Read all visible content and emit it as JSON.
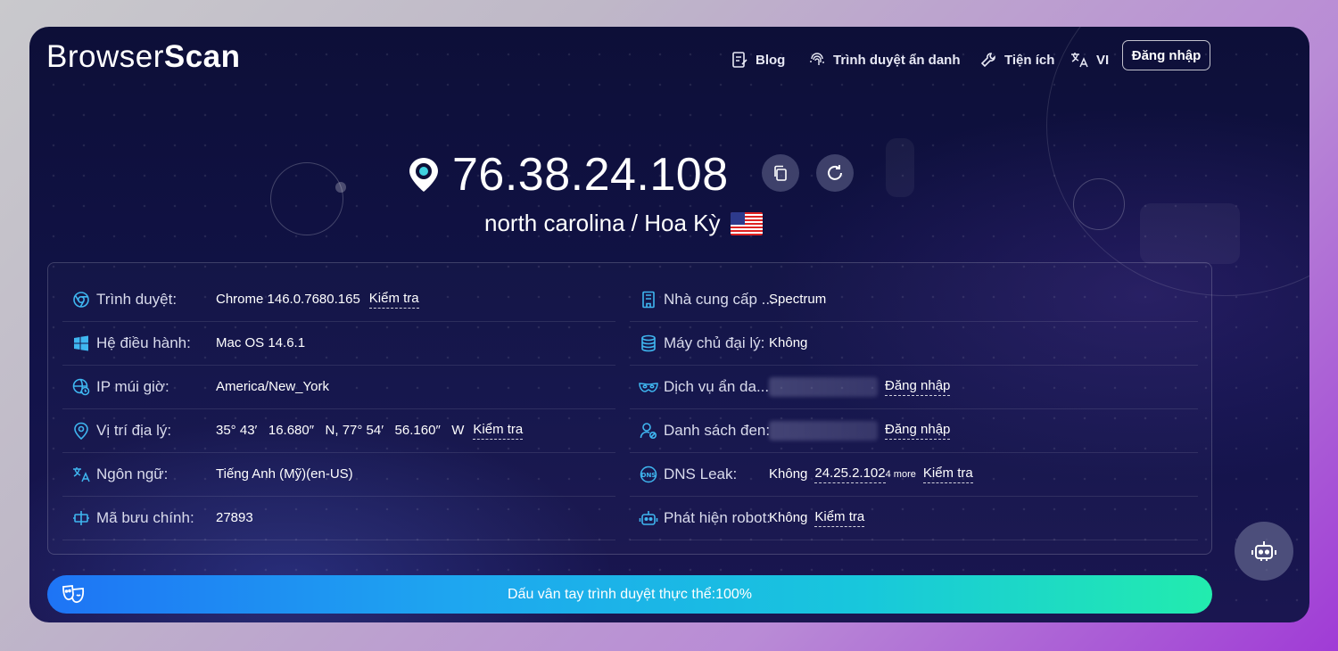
{
  "header": {
    "logo_regular": "Browser",
    "logo_bold": "Scan",
    "nav": {
      "blog": "Blog",
      "incognito": "Trình duyệt ẩn danh",
      "tools": "Tiện ích",
      "language": "VI"
    },
    "login": "Đăng nhập"
  },
  "hero": {
    "ip": "76.38.24.108",
    "location": "north carolina / Hoa Kỳ",
    "flag_icon": "us-flag-icon"
  },
  "info_left": [
    {
      "label": "Trình duyệt:",
      "value": "Chrome 146.0.7680.165",
      "link": "Kiểm tra",
      "icon": "chrome-icon"
    },
    {
      "label": "Hệ điều hành:",
      "value": "Mac OS 14.6.1",
      "icon": "windows-icon"
    },
    {
      "label": "IP múi giờ:",
      "value": "America/New_York",
      "icon": "globe-clock-icon"
    },
    {
      "label": "Vị trí địa lý:",
      "value": "35° 43′   16.680″   N, 77° 54′   56.160″   W",
      "link": "Kiểm tra",
      "icon": "location-pin-icon"
    },
    {
      "label": "Ngôn ngữ:",
      "value": "Tiếng Anh (Mỹ)(en-US)",
      "icon": "translate-icon"
    },
    {
      "label": "Mã bưu chính:",
      "value": "27893",
      "icon": "postal-icon"
    }
  ],
  "info_right": [
    {
      "label": "Nhà cung cấp ...",
      "value": "Spectrum",
      "icon": "building-icon"
    },
    {
      "label": "Máy chủ đại lý:",
      "value": "Không",
      "icon": "database-icon"
    },
    {
      "label": "Dịch vụ ẩn da...",
      "value": "",
      "link": "Đăng nhập",
      "icon": "mask-icon"
    },
    {
      "label": "Danh sách đen:",
      "value": "",
      "link": "Đăng nhập",
      "icon": "user-block-icon"
    },
    {
      "label": "DNS Leak:",
      "value": "Không",
      "dns_ip": "24.25.2.102",
      "more": "4 more",
      "link": "Kiểm tra",
      "icon": "dns-icon"
    },
    {
      "label": "Phát hiện robot:",
      "value": "Không",
      "link": "Kiểm tra",
      "icon": "robot-icon"
    }
  ],
  "fingerprint_bar": {
    "text": "Dấu vân tay trình duyệt thực thể:100%",
    "score_percent": 100
  },
  "colors": {
    "bg_dark": "#0d0f38",
    "bar_start": "#1e74f5",
    "bar_end": "#22ecae",
    "icon_accent": "#3fb6f0"
  }
}
